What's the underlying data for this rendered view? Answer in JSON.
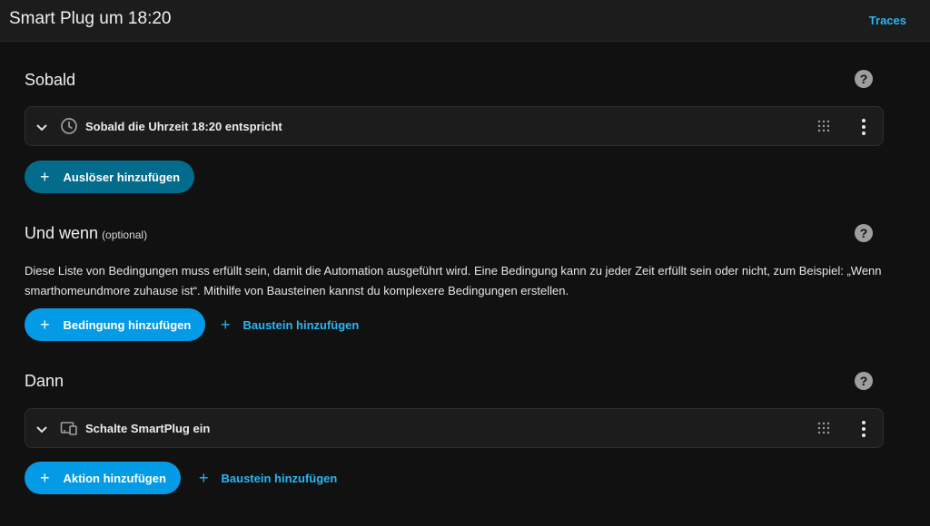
{
  "header": {
    "title": "Smart Plug um 18:20",
    "traces_label": "Traces"
  },
  "trigger_section": {
    "title": "Sobald",
    "card_text": "Sobald die Uhrzeit 18:20 entspricht",
    "add_label": "Auslöser hinzufügen"
  },
  "condition_section": {
    "title": "Und wenn",
    "optional": "(optional)",
    "description": "Diese Liste von Bedingungen muss erfüllt sein, damit die Automation ausgeführt wird. Eine Bedingung kann zu jeder Zeit erfüllt sein oder nicht, zum Beispiel: „Wenn smarthomeundmore zuhause ist“. Mithilfe von Bausteinen kannst du komplexere Bedingungen erstellen.",
    "add_label": "Bedingung hinzufügen",
    "block_label": "Baustein hinzufügen"
  },
  "action_section": {
    "title": "Dann",
    "card_text": "Schalte SmartPlug ein",
    "add_label": "Aktion hinzufügen",
    "block_label": "Baustein hinzufügen"
  },
  "icons": {
    "help": "help-circle-icon",
    "expand": "chevron-down-icon",
    "trigger": "clock-icon",
    "action": "devices-icon",
    "drag": "drag-grid-icon",
    "menu": "dots-vertical-icon",
    "add": "plus-icon"
  },
  "colors": {
    "accent": "#29b6f6",
    "primary_button": "#039be5",
    "trigger_button": "#036b8c",
    "background": "#111111",
    "card": "#1c1c1c"
  }
}
